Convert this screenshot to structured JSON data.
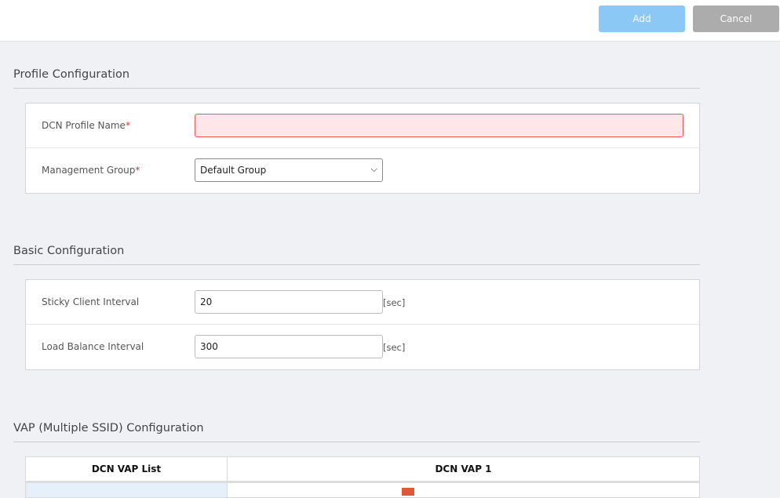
{
  "toolbar": {
    "add_label": "Add",
    "cancel_label": "Cancel"
  },
  "profile": {
    "title": "Profile Configuration",
    "name_label": "DCN Profile Name",
    "name_value": "",
    "group_label": "Management Group",
    "group_value": "Default Group",
    "required_mark": "*"
  },
  "basic": {
    "title": "Basic Configuration",
    "sticky_label": "Sticky Client Interval",
    "sticky_value": "20",
    "load_label": "Load Balance Interval",
    "load_value": "300",
    "unit": "[sec]"
  },
  "vap": {
    "title": "VAP (Multiple SSID) Configuration",
    "col1": "DCN VAP List",
    "col2": "DCN VAP 1"
  }
}
